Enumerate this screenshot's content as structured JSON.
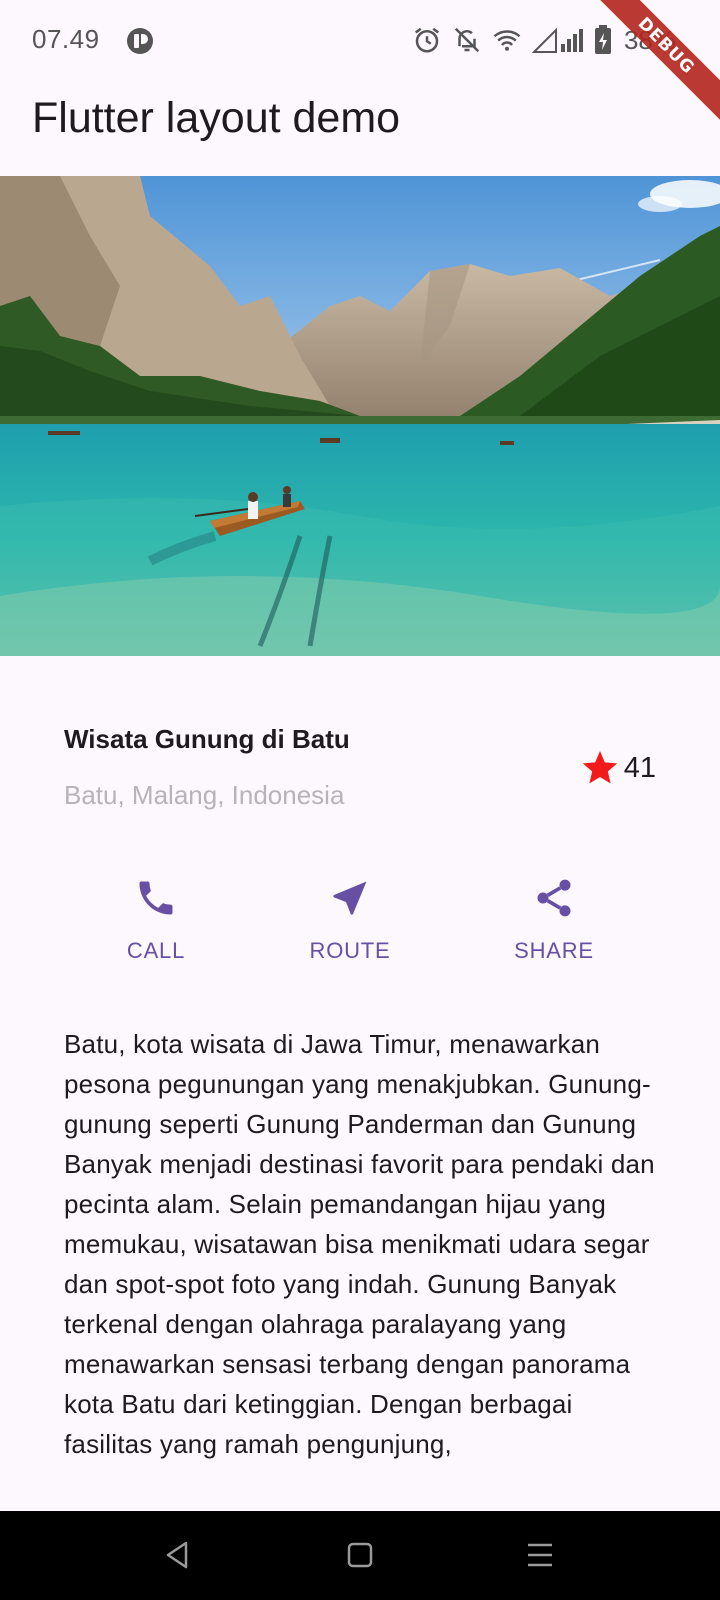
{
  "status_bar": {
    "time": "07.49",
    "battery": "38%",
    "icons": [
      "app-notification-icon",
      "alarm-icon",
      "notifications-off-icon",
      "wifi-icon",
      "cellular-signal-icon",
      "battery-charging-icon"
    ],
    "debug_banner": "DEBUG"
  },
  "app_bar": {
    "title": "Flutter layout demo"
  },
  "hero": {
    "alt": "mountain-lake-boat-photo"
  },
  "place": {
    "name": "Wisata Gunung di Batu",
    "location": "Batu, Malang, Indonesia",
    "rating_count": "41",
    "star_color": "#f21a1a"
  },
  "actions": [
    {
      "label": "CALL",
      "icon": "phone-icon"
    },
    {
      "label": "ROUTE",
      "icon": "near-me-icon"
    },
    {
      "label": "SHARE",
      "icon": "share-icon"
    }
  ],
  "accent_color": "#6750a4",
  "description": "Batu, kota wisata di Jawa Timur, menawarkan pesona pegunungan yang menakjubkan. Gunung-gunung seperti Gunung Panderman dan Gunung Banyak menjadi destinasi favorit para pendaki dan pecinta alam. Selain pemandangan hijau yang memukau, wisatawan bisa menikmati udara segar dan spot-spot foto yang indah. Gunung Banyak terkenal dengan olahraga paralayang yang menawarkan sensasi terbang dengan panorama kota Batu dari ketinggian. Dengan berbagai fasilitas yang ramah pengunjung,",
  "nav_bar": {
    "icons": [
      "back-icon",
      "home-icon",
      "recents-icon"
    ]
  }
}
